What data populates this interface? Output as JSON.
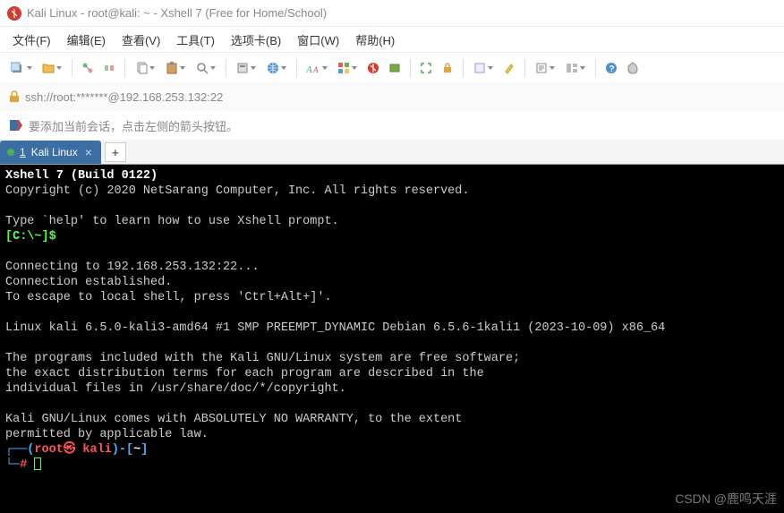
{
  "titlebar": {
    "text": "Kali Linux - root@kali: ~ - Xshell 7 (Free for Home/School)"
  },
  "menu": {
    "file": "文件(F)",
    "edit": "编辑(E)",
    "view": "查看(V)",
    "tools": "工具(T)",
    "tabs": "选项卡(B)",
    "window": "窗口(W)",
    "help": "帮助(H)"
  },
  "address": {
    "url": "ssh://root:*******@192.168.253.132:22"
  },
  "hint": {
    "text": "要添加当前会话，点击左侧的箭头按钮。"
  },
  "tabs": {
    "active": {
      "number": "1",
      "label": "Kali Linux"
    },
    "add": "+"
  },
  "terminal": {
    "l1": "Xshell 7 (Build 0122)",
    "l2": "Copyright (c) 2020 NetSarang Computer, Inc. All rights reserved.",
    "l3": "Type `help' to learn how to use Xshell prompt.",
    "prompt_local": "[C:\\~]$",
    "l4": "Connecting to 192.168.253.132:22...",
    "l5": "Connection established.",
    "l6": "To escape to local shell, press 'Ctrl+Alt+]'.",
    "l7": "Linux kali 6.5.0-kali3-amd64 #1 SMP PREEMPT_DYNAMIC Debian 6.5.6-1kali1 (2023-10-09) x86_64",
    "l8": "The programs included with the Kali GNU/Linux system are free software;",
    "l9": "the exact distribution terms for each program are described in the",
    "l10": "individual files in /usr/share/doc/*/copyright.",
    "l11": "Kali GNU/Linux comes with ABSOLUTELY NO WARRANTY, to the extent",
    "l12": "permitted by applicable law.",
    "p_corner1": "┌──(",
    "p_user": "root",
    "p_at": "㉿ ",
    "p_host": "kali",
    "p_corner2": ")-[",
    "p_path": "~",
    "p_corner3": "]",
    "p_line2a": "└─",
    "p_hash": "#"
  },
  "watermark": "CSDN @鹿鸣天涯"
}
